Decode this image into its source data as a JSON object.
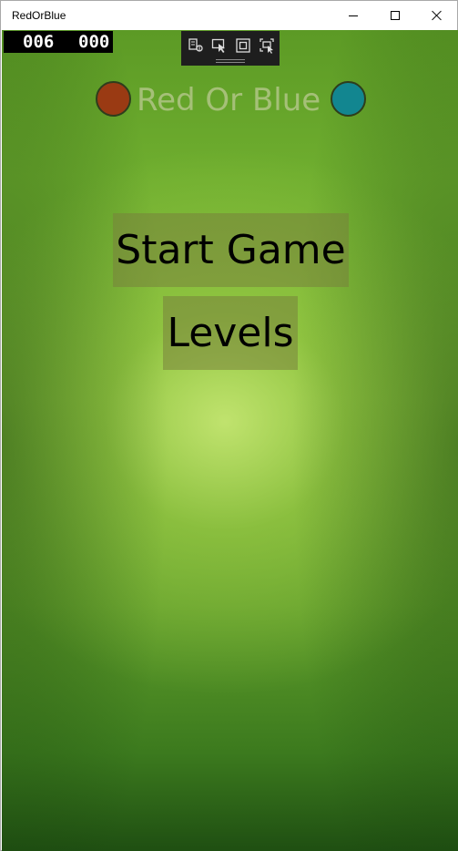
{
  "window": {
    "title": "RedOrBlue"
  },
  "debug_counter": {
    "left_value": "006",
    "right_value": "000"
  },
  "debug_toolbar": {
    "icons": [
      "live-visual-tree-icon",
      "select-element-icon",
      "display-layout-adorners-icon",
      "track-focus-icon"
    ]
  },
  "header": {
    "logo_text": "Red Or Blue",
    "red_dot_color": "#9a3a13",
    "blue_dot_color": "#128690"
  },
  "menu": {
    "start_label": "Start Game",
    "levels_label": "Levels"
  }
}
